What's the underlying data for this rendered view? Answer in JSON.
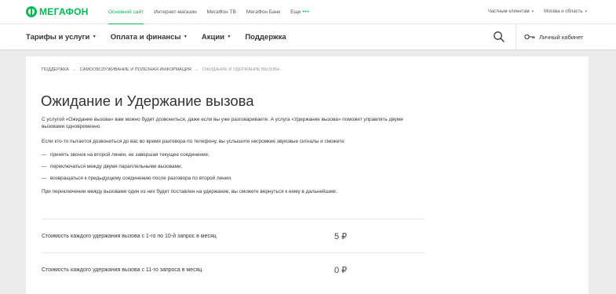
{
  "header": {
    "logo_text": "МЕГАФОН",
    "top_links": [
      {
        "label": "Основной сайт",
        "active": true
      },
      {
        "label": "Интернет-магазин",
        "active": false
      },
      {
        "label": "МегаФон ТВ",
        "active": false
      },
      {
        "label": "МегаФон Банк",
        "active": false
      },
      {
        "label": "Еще",
        "active": false
      }
    ],
    "more_dots": "•••",
    "segment": "Частным клиентам",
    "region": "Москва и область"
  },
  "nav": {
    "items": [
      "Тарифы и услуги",
      "Оплата и финансы",
      "Акции",
      "Поддержка"
    ],
    "cabinet_label": "Личный кабинет"
  },
  "breadcrumb": {
    "items": [
      "Поддержка",
      "Самообслуживание и полезная информация",
      "Ожидание и удержание вызова"
    ],
    "separator": "→"
  },
  "page": {
    "title": "Ожидание и Удержание вызова",
    "intro": "С услугой «Ожидание вызова» вам можно будет дозвониться, даже если вы уже разговариваете. А услуга «Удержание вызова» поможет управлять двумя вызовами одновременно.",
    "lead": "Если кто-то пытается дозвониться до вас во время разговора по телефону, вы услышите негромкие звуковые сигналы и сможете:",
    "bullet_mark": "—",
    "bullets": [
      "принять звонок на второй линии, не завершая текущее соединение;",
      "переключаться между двумя параллельными вызовами;",
      "возвращаться к предыдущему соединению после разговора по второй линии."
    ],
    "note": "При переключении между вызовами один из них будет поставлен на удержание, вы сможете вернуться к нему в дальнейшем."
  },
  "prices": [
    {
      "label": "Стоимость каждого удержания вызова с 1-го по 10-й запрос в месяц",
      "value": "5 ₽"
    },
    {
      "label": "Стоимость каждого удержания вызова с 11-го запроса в месяц",
      "value": "0 ₽"
    }
  ],
  "colors": {
    "brand": "#00b956",
    "text": "#333333",
    "background": "#ebebeb"
  }
}
